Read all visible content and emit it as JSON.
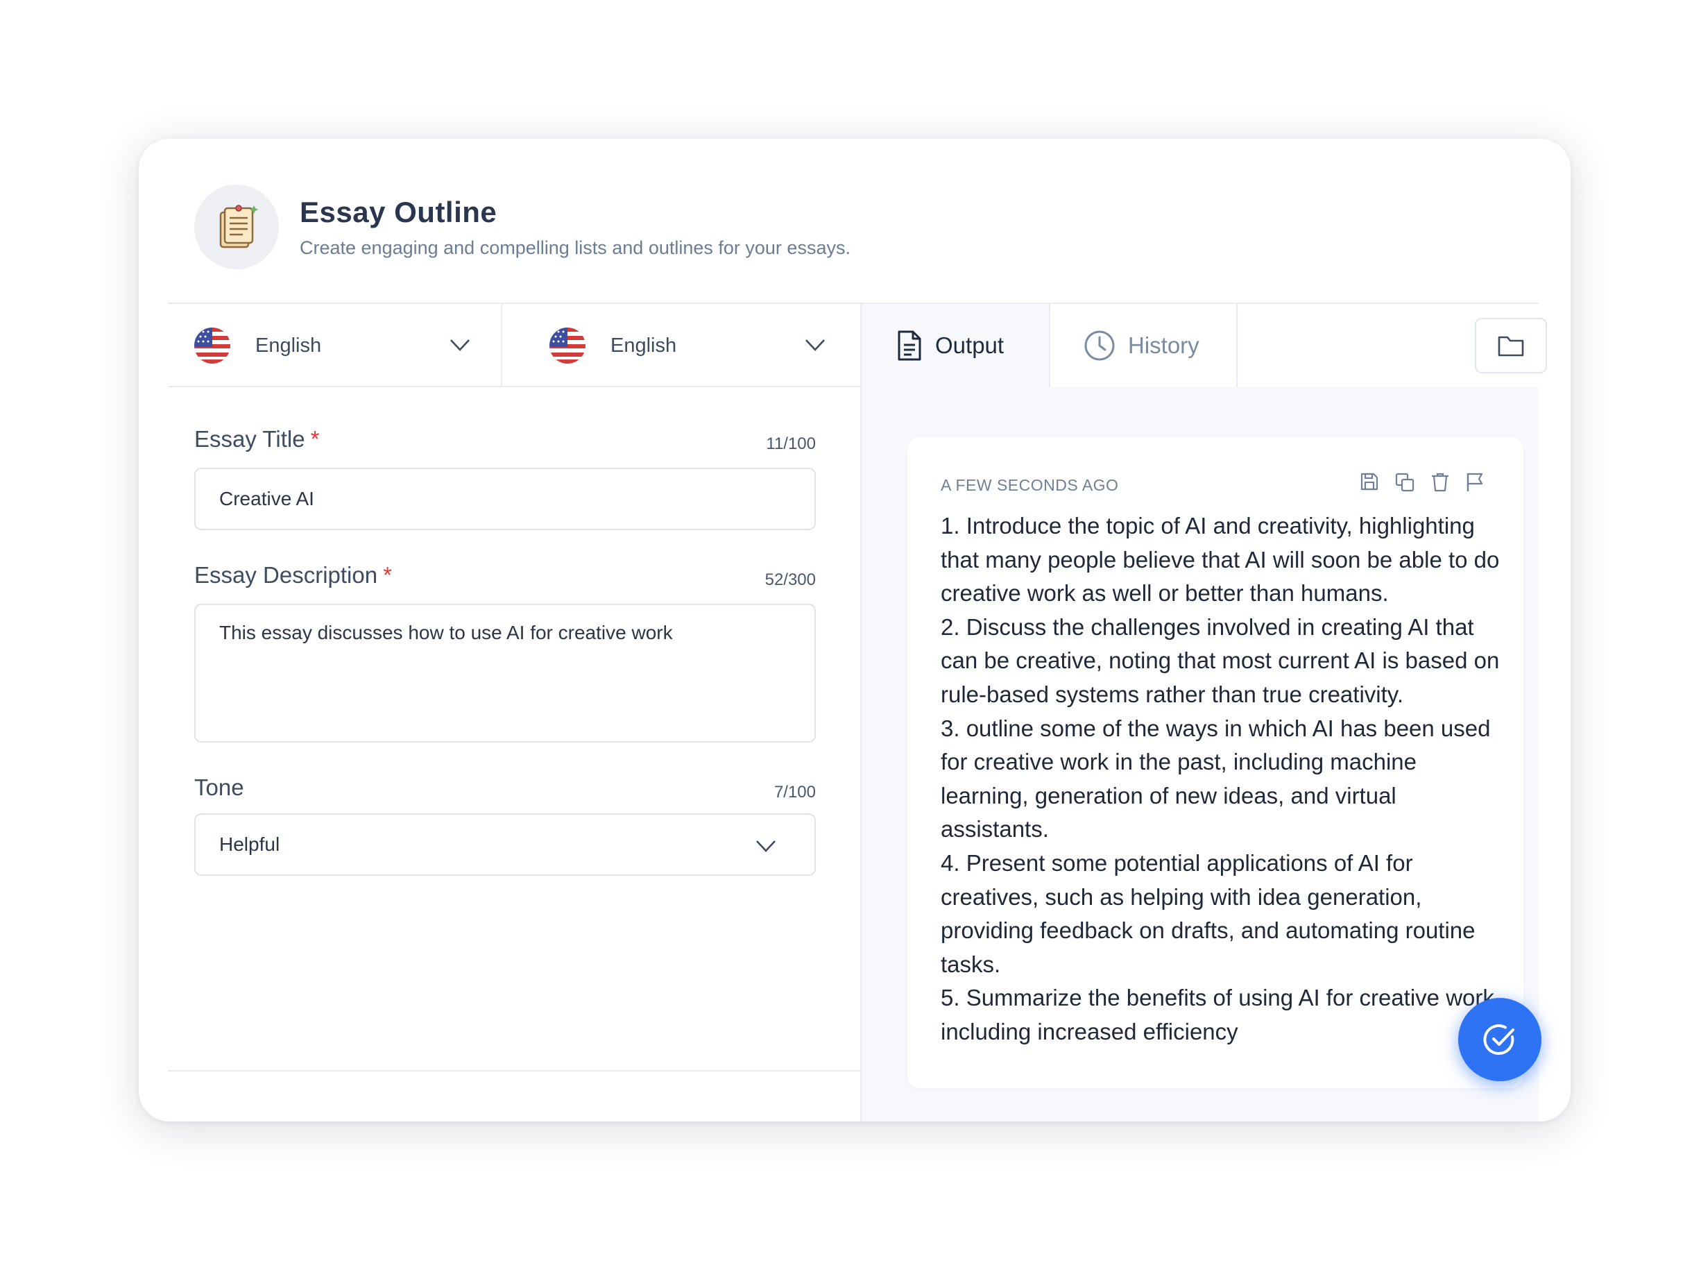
{
  "header": {
    "title": "Essay Outline",
    "subtitle": "Create engaging and compelling lists and outlines for your essays."
  },
  "languages": {
    "input_language": "English",
    "output_language": "English"
  },
  "form": {
    "title": {
      "label": "Essay Title",
      "required_mark": "*",
      "counter": "11/100",
      "value": "Creative AI"
    },
    "description": {
      "label": "Essay Description",
      "required_mark": "*",
      "counter": "52/300",
      "value": "This essay discusses how to use AI for creative work"
    },
    "tone": {
      "label": "Tone",
      "counter": "7/100",
      "value": "Helpful"
    }
  },
  "tabs": {
    "output": "Output",
    "history": "History"
  },
  "result": {
    "timestamp": "A FEW SECONDS AGO",
    "items": [
      "1. Introduce the topic of AI and creativity, highlighting that many people believe that AI will soon be able to do creative work as well or better than humans.",
      "2. Discuss the challenges involved in creating AI that can be creative, noting that most current AI is based on rule-based systems rather than true creativity.",
      "3. outline some of the ways in which AI has been used for creative work in the past, including machine learning, generation of new ideas, and virtual assistants.",
      "4. Present some potential applications of AI for creatives, such as helping with idea generation, providing feedback on drafts, and automating routine tasks.",
      "5. Summarize the benefits of using AI for creative work, including increased efficiency"
    ]
  },
  "colors": {
    "accent": "#2f73f5",
    "required": "#e53b3b",
    "panel_bg": "#f6f8fc"
  }
}
